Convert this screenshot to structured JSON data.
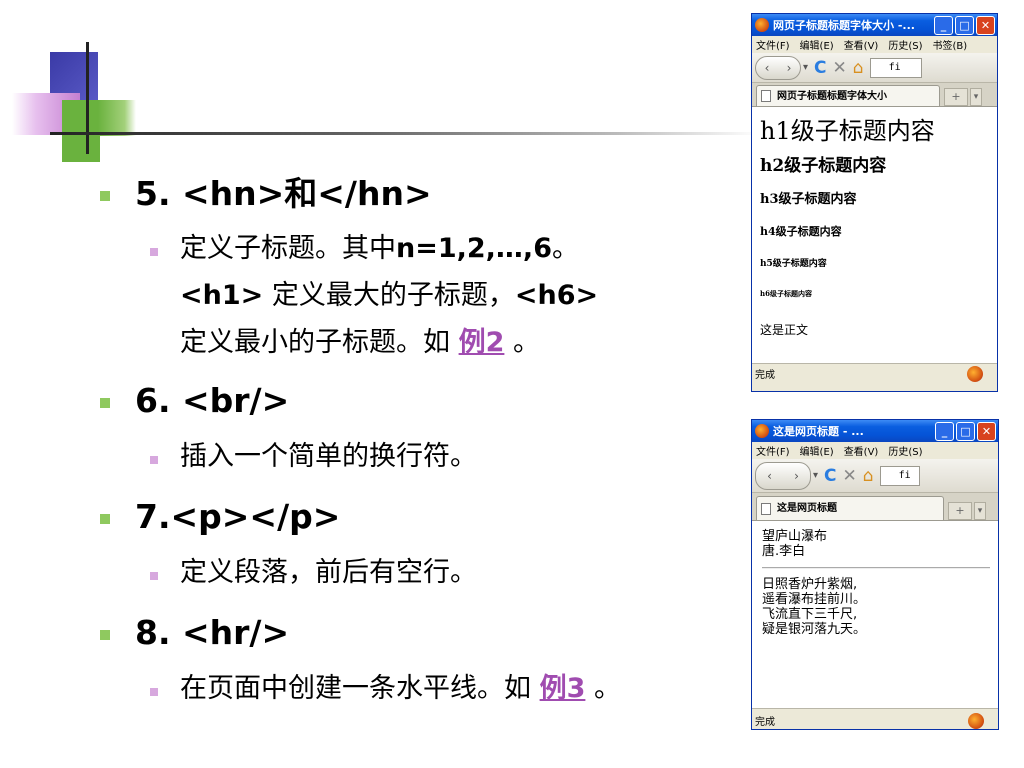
{
  "slide": {
    "items": [
      {
        "title": "5. <hn>和</hn>",
        "lines": [
          "定义子标题。其中",
          "n=1,2,…,6",
          "。",
          "<h1>",
          " 定义最大的子标题，",
          "<h6>",
          "定义最小的子标题。如 ",
          "例2",
          " 。"
        ]
      },
      {
        "title": "6. <br/>",
        "lines": [
          "插入一个简单的换行符。"
        ]
      },
      {
        "title": "7.<p></p>",
        "lines": [
          "定义段落，前后有空行。"
        ]
      },
      {
        "title": "8. <hr/>",
        "lines": [
          "在页面中创建一条水平线。如 ",
          "例3",
          " 。"
        ]
      }
    ]
  },
  "browser1": {
    "title": "网页子标题标题字体大小 -...",
    "menu": [
      "文件(F)",
      "编辑(E)",
      "查看(V)",
      "历史(S)",
      "书签(B)"
    ],
    "url": "fi",
    "tab_label": "网页子标题标题字体大小",
    "headings": [
      "h1级子标题内容",
      "h2级子标题内容",
      "h3级子标题内容",
      "h4级子标题内容",
      "h5级子标题内容",
      "h6级子标题内容"
    ],
    "body_text": "这是正文",
    "status": "完成"
  },
  "browser2": {
    "title": "这是网页标题 - ...",
    "menu": [
      "文件(F)",
      "编辑(E)",
      "查看(V)",
      "历史(S)"
    ],
    "url": "fi",
    "tab_label": "这是网页标题",
    "before_hr": [
      "望庐山瀑布",
      "唐.李白"
    ],
    "after_hr": [
      "日照香炉升紫烟,",
      "遥看瀑布挂前川。",
      "飞流直下三千尺,",
      "疑是银河落九天。"
    ],
    "status": "完成"
  },
  "colors": {
    "bullet_level1": "#8fc95f",
    "bullet_level2": "#d7a8de",
    "link": "#a04cb0",
    "titlebar": "#0553d6"
  }
}
